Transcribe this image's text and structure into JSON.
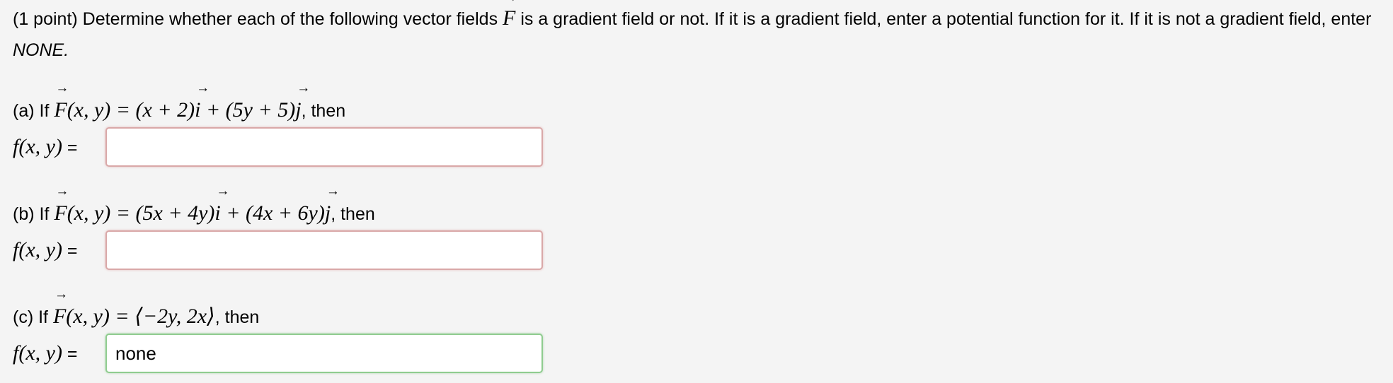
{
  "problem": {
    "points": "(1 point)",
    "intro_text": "Determine whether each of the following vector fields",
    "vector_symbol": "F",
    "intro_text_2": "is a gradient field or not. If it is a gradient field, enter a potential function for it. If it is not a gradient field, enter",
    "none_keyword": "NONE."
  },
  "parts": [
    {
      "label": "(a) If",
      "field_args": "(x, y) = (x + 2)",
      "i_unit": "i",
      "middle": " + (5y + 5)",
      "j_unit": "j",
      "then": ", then",
      "answer_label": "f(x, y)",
      "equals": " =",
      "answer_value": "",
      "state": "empty"
    },
    {
      "label": "(b) If",
      "field_args": "(x, y) = (5x + 4y)",
      "i_unit": "i",
      "middle": " + (4x + 6y)",
      "j_unit": "j",
      "then": ", then",
      "answer_label": "f(x, y)",
      "equals": " =",
      "answer_value": "",
      "state": "empty"
    },
    {
      "label": "(c) If",
      "field_args": "(x, y) = ⟨−2y, 2x⟩",
      "then": ", then",
      "answer_label": "f(x, y)",
      "equals": " =",
      "answer_value": "none",
      "state": "correct"
    }
  ],
  "colors": {
    "background": "#f4f4f4",
    "empty_border": "#d9a8a8",
    "correct_border": "#8fcc8f"
  }
}
